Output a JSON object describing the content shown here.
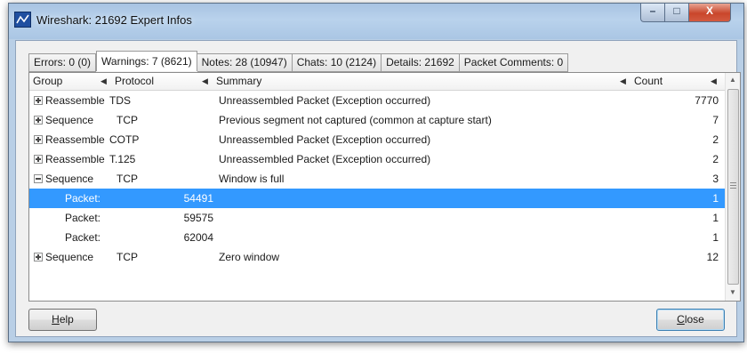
{
  "window": {
    "title": "Wireshark: 21692 Expert Infos",
    "controls": {
      "minimize": "–",
      "maximize": "□",
      "close": "X"
    }
  },
  "tabs": [
    {
      "label": "Errors: 0 (0)",
      "active": false
    },
    {
      "label": "Warnings: 7 (8621)",
      "active": true
    },
    {
      "label": "Notes: 28 (10947)",
      "active": false
    },
    {
      "label": "Chats: 10 (2124)",
      "active": false
    },
    {
      "label": "Details: 21692",
      "active": false
    },
    {
      "label": "Packet Comments: 0",
      "active": false
    }
  ],
  "table": {
    "columns": {
      "group": "Group",
      "protocol": "Protocol",
      "summary": "Summary",
      "count": "Count"
    },
    "rows": [
      {
        "kind": "group",
        "expander": "plus",
        "group": "Reassemble",
        "protocol": "TDS",
        "summary": "Unreassembled Packet (Exception occurred)",
        "count": "7770"
      },
      {
        "kind": "group",
        "expander": "plus",
        "group": "Sequence",
        "protocol": "TCP",
        "summary": "Previous segment not captured (common at capture start)",
        "count": "7"
      },
      {
        "kind": "group",
        "expander": "plus",
        "group": "Reassemble",
        "protocol": "COTP",
        "summary": "Unreassembled Packet (Exception occurred)",
        "count": "2"
      },
      {
        "kind": "group",
        "expander": "plus",
        "group": "Reassemble",
        "protocol": "T.125",
        "summary": "Unreassembled Packet (Exception occurred)",
        "count": "2"
      },
      {
        "kind": "group",
        "expander": "minus",
        "group": "Sequence",
        "protocol": "TCP",
        "summary": "Window is full",
        "count": "3"
      },
      {
        "kind": "child",
        "selected": true,
        "label": "Packet:",
        "packet": "54491",
        "count": "1"
      },
      {
        "kind": "child",
        "selected": false,
        "label": "Packet:",
        "packet": "59575",
        "count": "1"
      },
      {
        "kind": "child",
        "selected": false,
        "label": "Packet:",
        "packet": "62004",
        "count": "1"
      },
      {
        "kind": "group",
        "expander": "plus",
        "group": "Sequence",
        "protocol": "TCP",
        "summary": "Zero window",
        "count": "12"
      }
    ]
  },
  "buttons": {
    "help": {
      "mnemonic": "H",
      "rest": "elp"
    },
    "close": {
      "mnemonic": "C",
      "rest": "lose"
    }
  }
}
